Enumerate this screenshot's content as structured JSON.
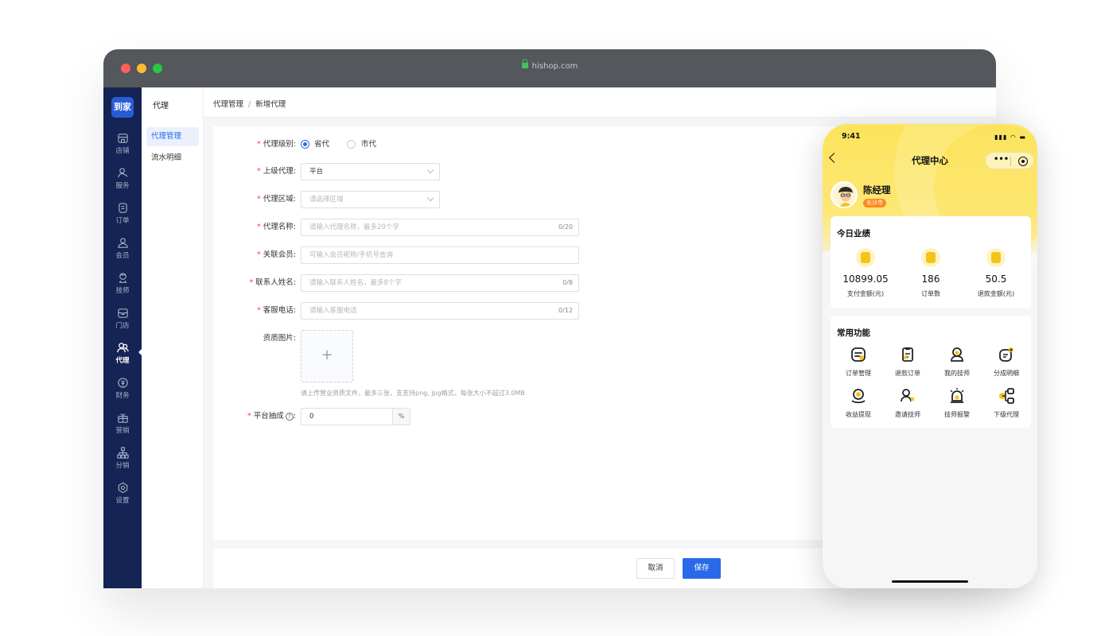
{
  "browser": {
    "url": "hishop.com",
    "logo": "到家",
    "nav": [
      {
        "label": "店铺",
        "icon": "store-icon"
      },
      {
        "label": "服务",
        "icon": "service-icon"
      },
      {
        "label": "订单",
        "icon": "order-icon"
      },
      {
        "label": "会员",
        "icon": "member-icon"
      },
      {
        "label": "技师",
        "icon": "technician-icon"
      },
      {
        "label": "门店",
        "icon": "shop-icon"
      },
      {
        "label": "代理",
        "icon": "agent-icon",
        "active": true
      },
      {
        "label": "财务",
        "icon": "finance-icon"
      },
      {
        "label": "营销",
        "icon": "marketing-icon"
      },
      {
        "label": "分销",
        "icon": "distribution-icon"
      },
      {
        "label": "设置",
        "icon": "settings-icon"
      }
    ],
    "submenu": {
      "title": "代理",
      "items": [
        "代理管理",
        "流水明细"
      ]
    },
    "breadcrumb": [
      "代理管理",
      "新增代理"
    ],
    "form": {
      "level": {
        "label": "代理级别:",
        "options": [
          "省代",
          "市代"
        ],
        "selected": "省代"
      },
      "parent": {
        "label": "上级代理:",
        "value": "平台"
      },
      "region": {
        "label": "代理区域:",
        "placeholder": "请选择区域"
      },
      "name": {
        "label": "代理名称:",
        "placeholder": "请输入代理名称，最多20个字",
        "counter": "0/20"
      },
      "member": {
        "label": "关联会员:",
        "placeholder": "可输入会员昵称/手机号查询"
      },
      "contact": {
        "label": "联系人姓名:",
        "placeholder": "请输入联系人姓名，最多8个字",
        "counter": "0/8"
      },
      "phone": {
        "label": "客服电话:",
        "placeholder": "请输入客服电话",
        "counter": "0/12"
      },
      "cert": {
        "label": "资质图片:",
        "plus": "+",
        "hint": "请上传营业资质文件，最多三张，支支持png, jpg格式，每张大小不超过3.0MB"
      },
      "commission": {
        "label": "平台抽成",
        "help": "?",
        "value": "0",
        "suffix": "%"
      }
    },
    "buttons": {
      "cancel": "取消",
      "save": "保存"
    },
    "colors": {
      "primary": "#2a6ae8",
      "nav_bg": "#142454",
      "required": "#f04848"
    }
  },
  "phone": {
    "time": "9:41",
    "status": "▮▮▮ ◠ ▬",
    "title": "代理中心",
    "capsule_dots": "•••",
    "user": {
      "name": "陈经理",
      "badge": "长沙市"
    },
    "today": {
      "title": "今日业绩",
      "stats": [
        {
          "value": "10899.05",
          "label": "支付金额(元)"
        },
        {
          "value": "186",
          "label": "订单数"
        },
        {
          "value": "50.5",
          "label": "退款金额(元)"
        }
      ]
    },
    "functions": {
      "title": "常用功能",
      "items": [
        {
          "label": "订单管理",
          "icon": "order-manage-icon"
        },
        {
          "label": "退款订单",
          "icon": "refund-order-icon"
        },
        {
          "label": "我的技师",
          "icon": "my-technician-icon"
        },
        {
          "label": "分成明细",
          "icon": "commission-detail-icon"
        },
        {
          "label": "收益提现",
          "icon": "withdraw-icon"
        },
        {
          "label": "邀请技师",
          "icon": "invite-technician-icon"
        },
        {
          "label": "技师报警",
          "icon": "technician-alarm-icon"
        },
        {
          "label": "下级代理",
          "icon": "sub-agent-icon"
        }
      ]
    },
    "colors": {
      "accent": "#f6c419",
      "badge": "#ff8a1f"
    }
  }
}
